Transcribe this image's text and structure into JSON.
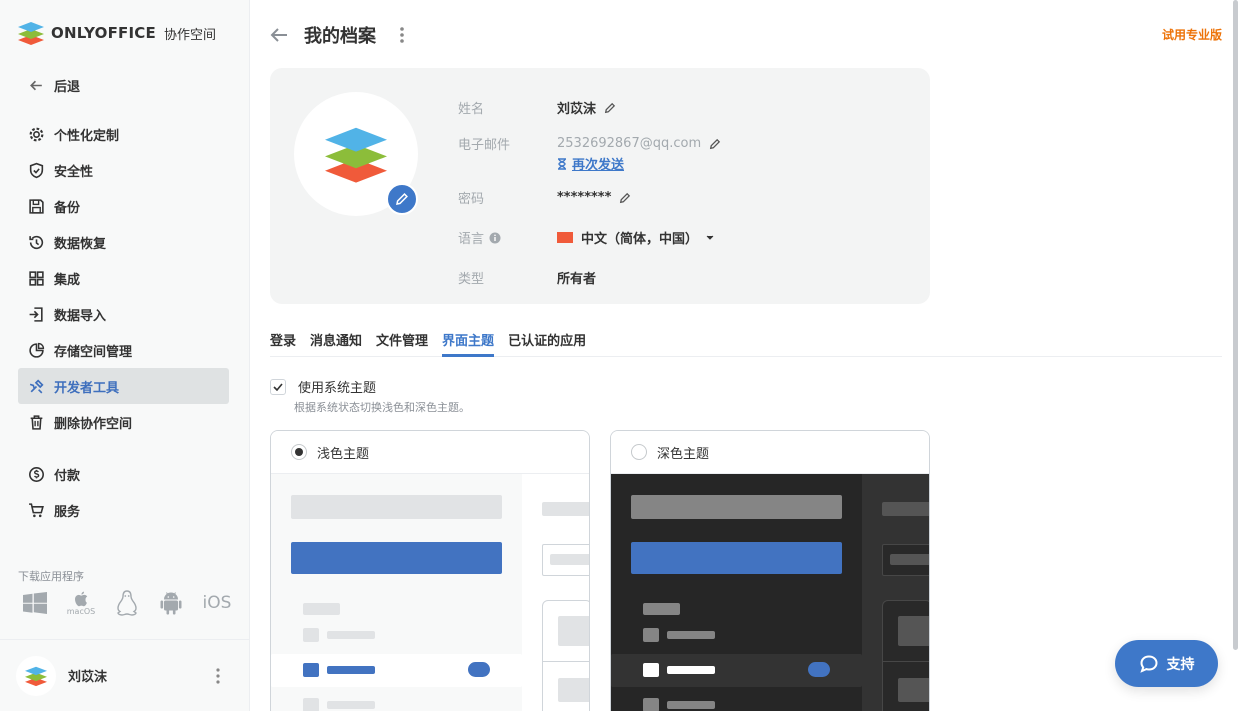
{
  "sidebar": {
    "logo": {
      "brand": "ONLYOFFICE",
      "sub": "协作空间"
    },
    "back_label": "后退",
    "items": [
      {
        "label": "个性化定制",
        "icon": "gear-icon"
      },
      {
        "label": "安全性",
        "icon": "shield-icon"
      },
      {
        "label": "备份",
        "icon": "floppy-icon"
      },
      {
        "label": "数据恢复",
        "icon": "restore-icon"
      },
      {
        "label": "集成",
        "icon": "grid-icon"
      },
      {
        "label": "数据导入",
        "icon": "import-icon"
      },
      {
        "label": "存储空间管理",
        "icon": "pie-icon"
      },
      {
        "label": "开发者工具",
        "icon": "tools-icon",
        "active": true
      },
      {
        "label": "删除协作空间",
        "icon": "trash-icon"
      },
      {
        "label": "付款",
        "icon": "coin-icon"
      },
      {
        "label": "服务",
        "icon": "cart-icon"
      }
    ],
    "download_title": "下载应用程序",
    "download_apps": [
      "windows-icon",
      "macos-icon",
      "linux-icon",
      "android-icon",
      "ios-icon"
    ],
    "macos_label": "macOS",
    "ios_label": "iOS",
    "user_name": "刘苡沫"
  },
  "header": {
    "title": "我的档案",
    "trial_label": "试用专业版"
  },
  "profile": {
    "name_label": "姓名",
    "name_value": "刘苡沫",
    "email_label": "电子邮件",
    "email_value": "2532692867@qq.com",
    "resend_label": "再次发送",
    "password_label": "密码",
    "password_value": "********",
    "language_label": "语言",
    "language_value": "中文（简体，中国）",
    "type_label": "类型",
    "type_value": "所有者"
  },
  "tabs": [
    {
      "label": "登录"
    },
    {
      "label": "消息通知"
    },
    {
      "label": "文件管理"
    },
    {
      "label": "界面主题",
      "active": true
    },
    {
      "label": "已认证的应用"
    }
  ],
  "theme": {
    "use_system_label": "使用系统主题",
    "use_system_checked": true,
    "use_system_desc": "根据系统状态切换浅色和深色主题。",
    "light_label": "浅色主题",
    "dark_label": "深色主题",
    "selected": "light"
  },
  "support_label": "支持",
  "colors": {
    "accent": "#3e78c9",
    "trial": "#ed7309",
    "active_nav": "#3e6fbd"
  }
}
